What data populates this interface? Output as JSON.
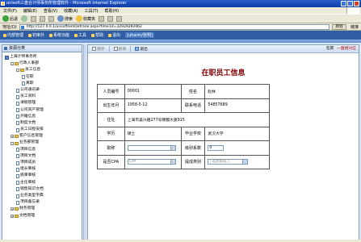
{
  "window": {
    "title": "unisoft三盘合计师事务所管理软件 - Microsoft Internet Explorer"
  },
  "menu": [
    "文件(F)",
    "编辑(E)",
    "查看(V)",
    "收藏(A)",
    "工具(T)",
    "帮助(H)"
  ],
  "toolbar": {
    "back": "后退",
    "search": "搜索",
    "favorites": "收藏夹"
  },
  "address": {
    "label": "地址(D)",
    "url": "http://127.0.0.1/unsoft/emDefrane.aspx?time1d=32929292062",
    "go": "转到",
    "links": "链接"
  },
  "nav": {
    "items": [
      "内部管理",
      "初审外",
      "系统功能",
      "工具",
      "帮助",
      "退出"
    ],
    "user": "[uharm/张明]"
  },
  "sidebar": {
    "title": "资源分类",
    "nodes": [
      {
        "label": "上海计师事务所",
        "level": 0,
        "icon": "root"
      },
      {
        "label": "行政人事部",
        "level": 1,
        "icon": "folder",
        "exp": "-"
      },
      {
        "label": "员工信息",
        "level": 2,
        "icon": "folder",
        "exp": "-"
      },
      {
        "label": "在职",
        "level": 3,
        "icon": "doc",
        "selected": true
      },
      {
        "label": "离职",
        "level": 3,
        "icon": "doc"
      },
      {
        "label": "公司通讯录",
        "level": 2,
        "icon": "doc"
      },
      {
        "label": "员工资料",
        "level": 2,
        "icon": "doc"
      },
      {
        "label": "请假管理",
        "level": 2,
        "icon": "doc"
      },
      {
        "label": "公司资产管理",
        "level": 2,
        "icon": "doc"
      },
      {
        "label": "外籍信息",
        "level": 2,
        "icon": "doc"
      },
      {
        "label": "制度文档",
        "level": 2,
        "icon": "doc"
      },
      {
        "label": "员工日程安排",
        "level": 2,
        "icon": "doc"
      },
      {
        "label": "客户信息管理",
        "level": 1,
        "icon": "folder",
        "exp": "+"
      },
      {
        "label": "业务部管理",
        "level": 1,
        "icon": "folder",
        "exp": "-"
      },
      {
        "label": "项目信息",
        "level": 2,
        "icon": "doc"
      },
      {
        "label": "项目文档",
        "level": 2,
        "icon": "doc"
      },
      {
        "label": "项目成员",
        "level": 2,
        "icon": "doc"
      },
      {
        "label": "组长审核",
        "level": 2,
        "icon": "doc"
      },
      {
        "label": "底审审核",
        "level": 2,
        "icon": "doc"
      },
      {
        "label": "主任审核",
        "level": 2,
        "icon": "doc"
      },
      {
        "label": "销售知识文档",
        "level": 2,
        "icon": "doc"
      },
      {
        "label": "业务类型字典",
        "level": 2,
        "icon": "doc"
      },
      {
        "label": "项目备忘录",
        "level": 2,
        "icon": "doc"
      },
      {
        "label": "财务管理",
        "level": 1,
        "icon": "folder",
        "exp": "+"
      },
      {
        "label": "文档管理",
        "level": 1,
        "icon": "folder",
        "exp": "+"
      }
    ]
  },
  "content_toolbar": {
    "save": "保存",
    "new": "新增",
    "exit": "退出",
    "right_label": "在职",
    "right_link": "一盘相对应"
  },
  "form": {
    "title": "在职员工信息",
    "labels": {
      "emp_no": "人员编号",
      "name": "姓名",
      "birth": "出生年月",
      "phone": "联系电话",
      "address": "住址",
      "education": "学历",
      "school": "毕业学校",
      "position": "职称",
      "level": "级别系数",
      "is_cpa": "是否CPA",
      "commission": "提成类别"
    },
    "values": {
      "emp_no": "00001",
      "name": "赵林",
      "birth": "1958-5-12",
      "phone": "54857689",
      "address": "上海市吴兴路277号锦都大厦915",
      "education": "硕士",
      "school": "武汉大学",
      "position": "",
      "level": "0",
      "is_cpa": "CPA",
      "commission": "[ 选加提成 ]"
    }
  }
}
